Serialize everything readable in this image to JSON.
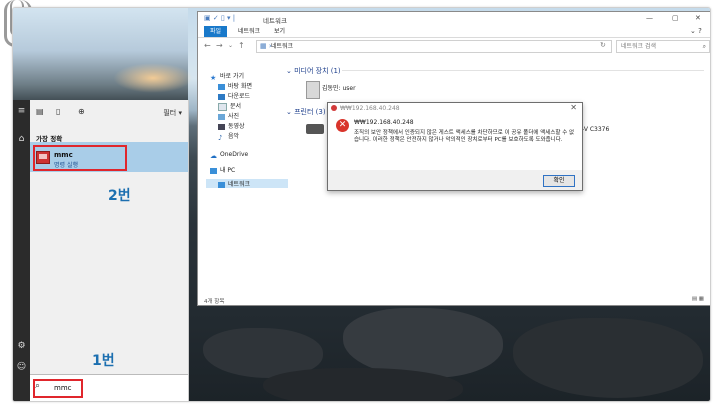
{
  "explorer": {
    "title": "네트워크",
    "tabs": [
      "파일",
      "네트워크",
      "보기"
    ],
    "address": "네트워크",
    "search_placeholder": "네트워크 검색",
    "nav_items": [
      "바로 가기",
      "바탕 화면",
      "다운로드",
      "문서",
      "사진",
      "동영상",
      "음악",
      "OneDrive",
      "내 PC",
      "네트워크"
    ],
    "group_media": "미디어 장치 (1)",
    "media_device": "김동민: user",
    "group_printers": "프린터 (3)",
    "printer_partial": "-V C3376",
    "status": "4개 항목"
  },
  "dialog": {
    "title": "₩₩192.168.40.248",
    "host": "₩₩192.168.40.248",
    "message": "조직의 보안 정책에서 인증되지 않은 게스트 액세스를 차단하므로 이 공유 폴더에 액세스할 수 없습니다. 이러한 정책은 안전하지 않거나 악의적인 장치로부터 PC를 보호하도록 도와줍니다.",
    "ok_label": "확인"
  },
  "start": {
    "filter_label": "필터",
    "best_match_label": "가장 정확",
    "app_name": "mmc",
    "app_sub": "명령 실행",
    "search_text": "mmc"
  },
  "annotations": {
    "step2": "2번",
    "step1": "1번"
  }
}
